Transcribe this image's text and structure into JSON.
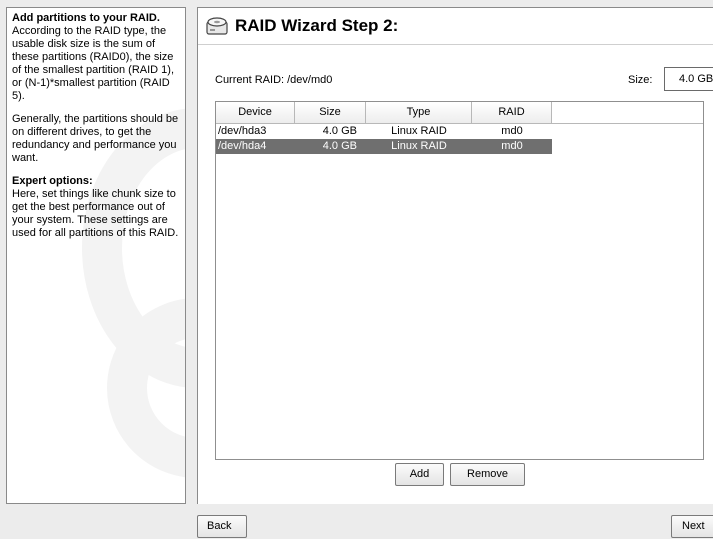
{
  "help": {
    "heading1": "Add partitions to your RAID.",
    "para1": " According to the RAID type, the usable disk size is the sum of these partitions (RAID0), the size of the smallest partition (RAID 1), or (N-1)*smallest partition (RAID 5).",
    "para2": "Generally, the partitions should be on different drives, to get the redundancy and performance you want.",
    "heading2": "Expert options:",
    "para3": "Here, set things like chunk size to get the best performance out of your system. These settings are used for all partitions of this RAID."
  },
  "header": {
    "title": "RAID Wizard Step 2:",
    "icon": "hard-disk-icon"
  },
  "current_raid": {
    "label": "Current RAID: /dev/md0"
  },
  "size": {
    "label": "Size:",
    "value": "4.0 GB"
  },
  "table": {
    "columns": [
      "Device",
      "Size",
      "Type",
      "RAID"
    ],
    "rows": [
      {
        "device": "/dev/hda3",
        "size": "4.0 GB",
        "type": "Linux RAID",
        "raid": "md0",
        "selected": false
      },
      {
        "device": "/dev/hda4",
        "size": "4.0 GB",
        "type": "Linux RAID",
        "raid": "md0",
        "selected": true
      }
    ]
  },
  "buttons": {
    "add": "Add",
    "remove": "Remove",
    "back": "Back",
    "next": "Next"
  },
  "colors": {
    "selection": "#6f6f6f",
    "background": "#ececec"
  }
}
